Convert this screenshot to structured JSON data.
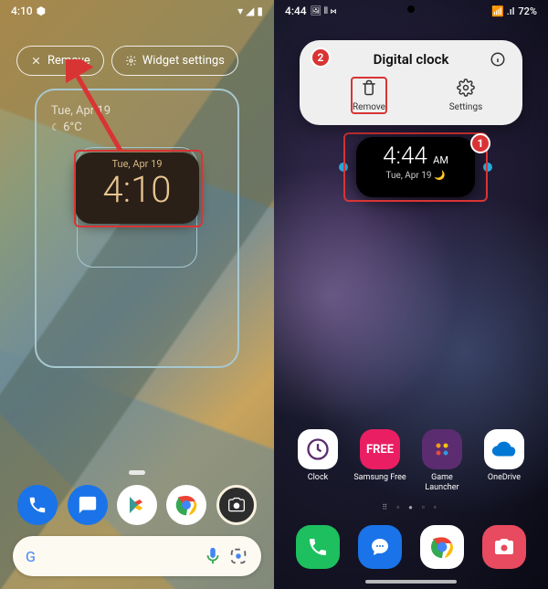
{
  "pixel": {
    "status": {
      "time": "4:10",
      "icons_left": "⬢",
      "icons_right": "▾ ◢ ▮"
    },
    "toolbar": {
      "remove_label": "Remove",
      "settings_label": "Widget settings"
    },
    "weather": {
      "date": "Tue, Apr 19",
      "temp": "6°C",
      "moon": "☾"
    },
    "widget": {
      "date": "Tue, Apr 19",
      "time": "4:10"
    },
    "dock": {
      "phone": "phone",
      "messages": "messages",
      "play": "play-store",
      "chrome": "chrome",
      "camera": "camera"
    },
    "search": {
      "logo": "G",
      "mic": "mic",
      "lens": "lens"
    }
  },
  "samsung": {
    "status": {
      "time": "4:44",
      "icons_left": "🖼 ⫴ ⋈",
      "battery": "72%",
      "signal": "📶 .ıl"
    },
    "context": {
      "title": "Digital clock",
      "remove_label": "Remove",
      "settings_label": "Settings"
    },
    "badges": {
      "one": "1",
      "two": "2"
    },
    "widget": {
      "time": "4:44",
      "ampm": "AM",
      "date": "Tue, Apr 19 🌙"
    },
    "apps": {
      "clock": "Clock",
      "free": "Samsung Free",
      "free_icon": "FREE",
      "game": "Game Launcher",
      "onedrive": "OneDrive"
    },
    "page_dots": "⠿ ▫ ● ▫ ▫",
    "dock": {
      "phone": "phone",
      "messages": "messages",
      "chrome": "chrome",
      "camera": "camera"
    }
  }
}
